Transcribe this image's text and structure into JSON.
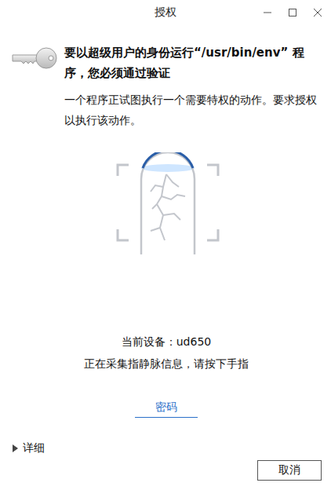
{
  "window": {
    "title": "授权"
  },
  "heading": "要以超级用户的身份运行“/usr/bin/env” 程序，您必须通过验证",
  "description": "一个程序正试图执行一个需要特权的动作。要求授权以执行该动作。",
  "device": "当前设备：ud650",
  "status": "正在采集指静脉信息，请按下手指",
  "password_link": "密码",
  "details": {
    "label": "详细",
    "expanded": false
  },
  "buttons": [
    "取消"
  ]
}
